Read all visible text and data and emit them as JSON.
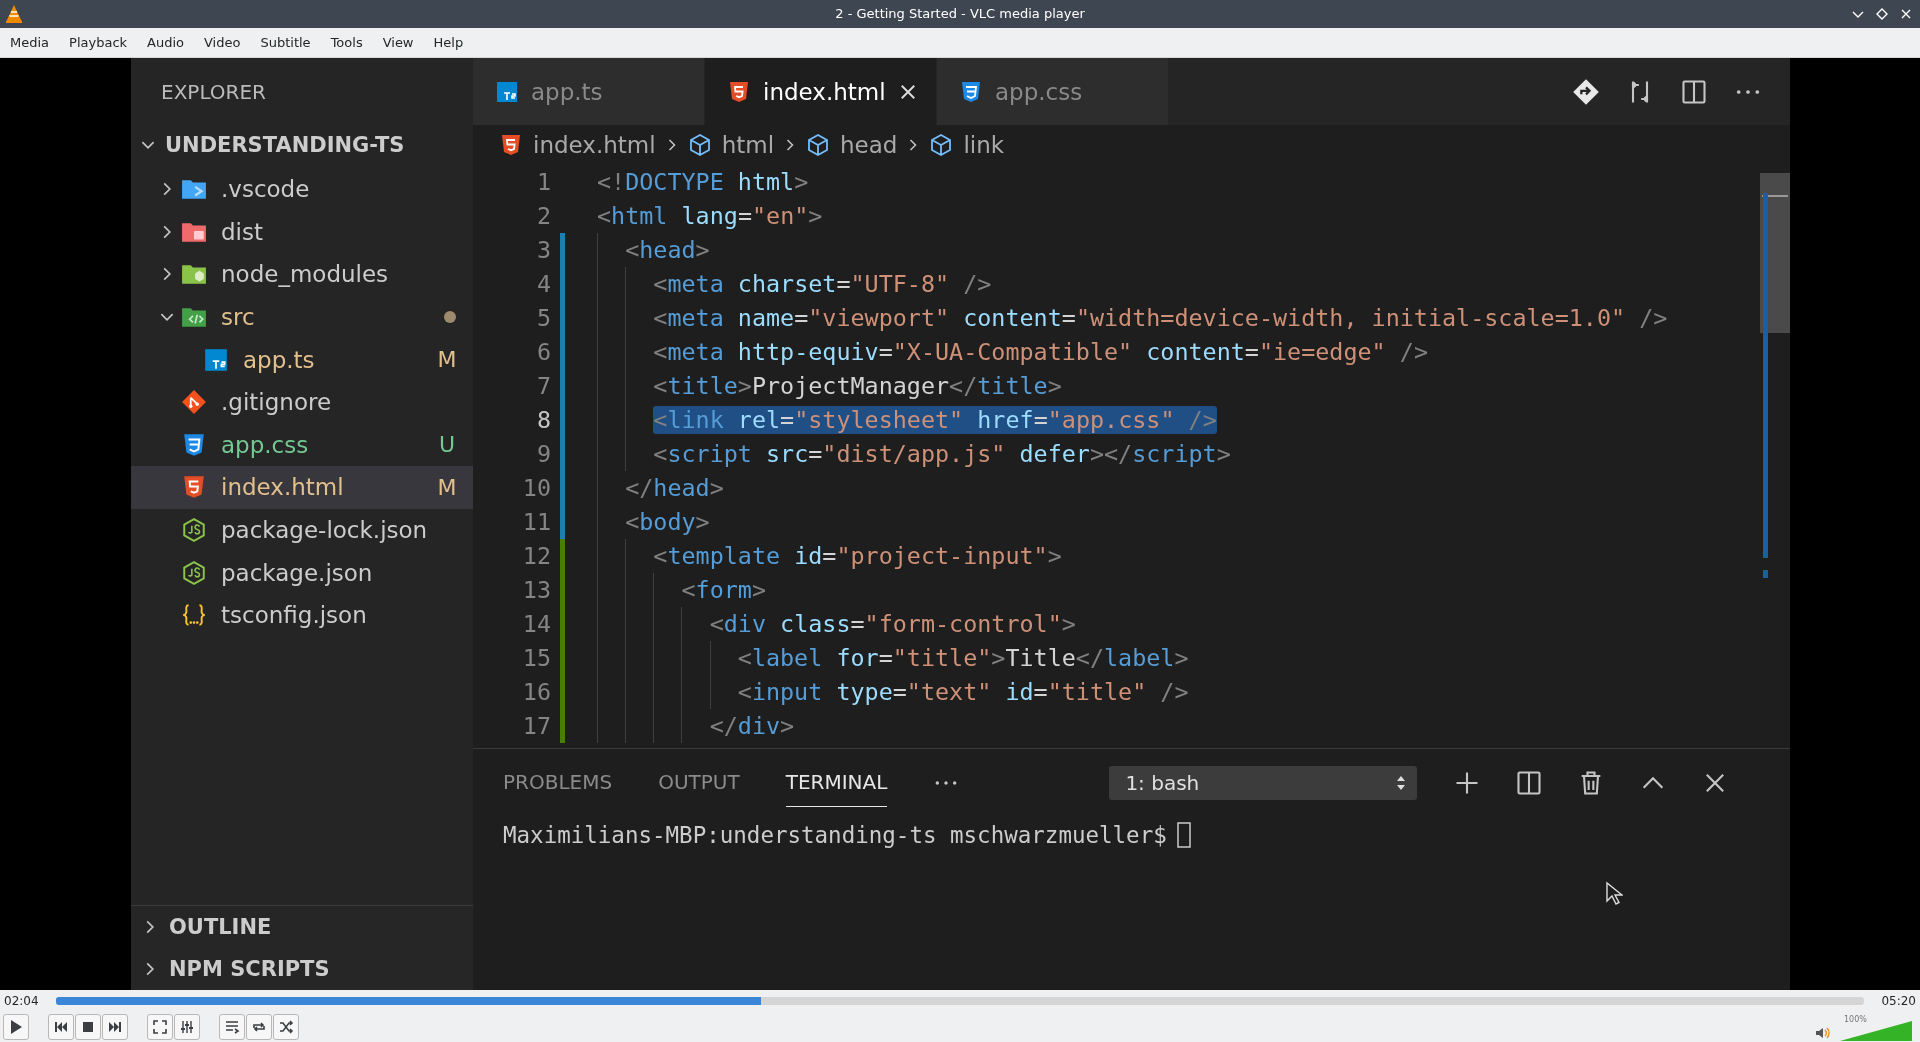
{
  "window": {
    "title": "2 - Getting Started - VLC media player"
  },
  "menu": [
    "Media",
    "Playback",
    "Audio",
    "Video",
    "Subtitle",
    "Tools",
    "View",
    "Help"
  ],
  "video": {
    "explorer": {
      "title": "EXPLORER",
      "project": {
        "label": "UNDERSTANDING-TS",
        "expanded": true
      },
      "tree": [
        {
          "label": ".vscode",
          "kind": "vscode",
          "expanded": false,
          "selected": false,
          "has_changes": false,
          "color": "#cccccc"
        },
        {
          "label": "dist",
          "kind": "dist",
          "expanded": false,
          "selected": false,
          "has_changes": false,
          "color": "#cccccc"
        },
        {
          "label": "node_modules",
          "kind": "node",
          "expanded": false,
          "selected": false,
          "has_changes": false,
          "color": "#cccccc"
        },
        {
          "label": "src",
          "kind": "src",
          "expanded": true,
          "selected": false,
          "has_changes": true,
          "color": "#e2c08d",
          "children": [
            {
              "label": "app.ts",
              "kind": "ts",
              "selected": false,
              "has_changes": false,
              "color": "#e2c08d",
              "badge": "M"
            }
          ]
        },
        {
          "label": ".gitignore",
          "kind": "git",
          "selected": false,
          "has_changes": false,
          "color": "#cccccc"
        },
        {
          "label": "app.css",
          "kind": "css",
          "selected": false,
          "has_changes": false,
          "color": "#73c991",
          "badge": "U"
        },
        {
          "label": "index.html",
          "kind": "html",
          "selected": true,
          "has_changes": false,
          "color": "#e2c08d",
          "badge": "M"
        },
        {
          "label": "package-lock.json",
          "kind": "json",
          "selected": false,
          "has_changes": false,
          "color": "#cccccc"
        },
        {
          "label": "package.json",
          "kind": "json",
          "selected": false,
          "has_changes": false,
          "color": "#cccccc"
        },
        {
          "label": "tsconfig.json",
          "kind": "config",
          "selected": false,
          "has_changes": false,
          "color": "#cccccc"
        }
      ],
      "sections": [
        {
          "label": "OUTLINE",
          "expanded": false
        },
        {
          "label": "NPM SCRIPTS",
          "expanded": false
        }
      ]
    },
    "tabs": [
      {
        "label": "app.ts",
        "kind": "ts",
        "selected": false
      },
      {
        "label": "index.html",
        "kind": "html",
        "selected": true
      },
      {
        "label": "app.css",
        "kind": "css",
        "selected": false
      }
    ],
    "breadcrumbs": [
      {
        "label": "index.html",
        "kind": "html"
      },
      {
        "label": "html",
        "kind": "symbol"
      },
      {
        "label": "head",
        "kind": "symbol"
      },
      {
        "label": "link",
        "kind": "symbol"
      }
    ],
    "code": [
      {
        "number": "1",
        "text": "<!DOCTYPE html>",
        "selected": false
      },
      {
        "number": "2",
        "text": "<html lang=\"en\">",
        "selected": false
      },
      {
        "number": "3",
        "text": "  <head>",
        "color": "#1b81a8",
        "selected": false
      },
      {
        "number": "4",
        "text": "    <meta charset=\"UTF-8\" />",
        "color": "#1b81a8",
        "selected": false
      },
      {
        "number": "5",
        "text": "    <meta name=\"viewport\" content=\"width=device-width, initial-scale=1.0\" />",
        "color": "#1b81a8",
        "selected": false
      },
      {
        "number": "6",
        "text": "    <meta http-equiv=\"X-UA-Compatible\" content=\"ie=edge\" />",
        "color": "#1b81a8",
        "selected": false
      },
      {
        "number": "7",
        "text": "    <title>ProjectManager</title>",
        "color": "#1b81a8",
        "selected": false
      },
      {
        "number": "8",
        "text": "    <link rel=\"stylesheet\" href=\"app.css\" />",
        "color": "#1b81a8",
        "selected": true
      },
      {
        "number": "9",
        "text": "    <script src=\"dist/app.js\" defer></script>",
        "color": "#1b81a8",
        "selected": false
      },
      {
        "number": "10",
        "text": "  </head>",
        "color": "#1b81a8",
        "selected": false
      },
      {
        "number": "11",
        "text": "  <body>",
        "color": "#1b81a8",
        "selected": false
      },
      {
        "number": "12",
        "text": "    <template id=\"project-input\">",
        "color": "#487e02",
        "selected": false
      },
      {
        "number": "13",
        "text": "      <form>",
        "color": "#487e02",
        "selected": false
      },
      {
        "number": "14",
        "text": "        <div class=\"form-control\">",
        "color": "#487e02",
        "selected": false
      },
      {
        "number": "15",
        "text": "          <label for=\"title\">Title</label>",
        "color": "#487e02",
        "selected": false
      },
      {
        "number": "16",
        "text": "          <input type=\"text\" id=\"title\" />",
        "color": "#487e02",
        "selected": false
      },
      {
        "number": "17",
        "text": "        </div>",
        "color": "#487e02",
        "selected": false
      }
    ],
    "panel": {
      "tabs": [
        {
          "label": "PROBLEMS",
          "selected": false
        },
        {
          "label": "OUTPUT",
          "selected": false
        },
        {
          "label": "TERMINAL",
          "selected": true
        }
      ],
      "terminal_select": {
        "value": "1: bash"
      },
      "terminal_lines": [
        "Maximilians-MBP:understanding-ts mschwarzmueller$"
      ]
    }
  },
  "player": {
    "elapsed": "02:04",
    "total": "05:20",
    "progress": {
      "level": 0.39
    },
    "volume": {
      "level": 1,
      "reading": "100%"
    }
  }
}
